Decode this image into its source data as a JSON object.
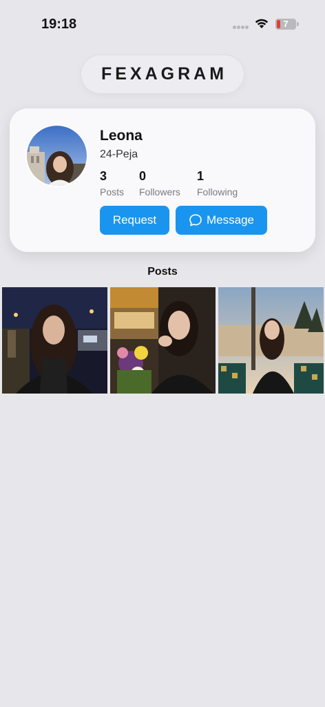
{
  "status_bar": {
    "time": "19:18",
    "battery_level": "7",
    "icons": [
      "cellular-dots-icon",
      "wifi-icon",
      "battery-icon"
    ]
  },
  "app": {
    "logo": "FEXAGRAM"
  },
  "profile": {
    "name": "Leona",
    "subtitle": "24-Peja",
    "stats": [
      {
        "value": "3",
        "label": "Posts"
      },
      {
        "value": "0",
        "label": "Followers"
      },
      {
        "value": "1",
        "label": "Following"
      }
    ],
    "request_label": "Request",
    "message_label": "Message"
  },
  "posts": {
    "heading": "Posts",
    "items": [
      {
        "name": "post-night-street"
      },
      {
        "name": "post-flowers-cafe"
      },
      {
        "name": "post-window-seaside"
      }
    ]
  },
  "colors": {
    "background": "#e7e7eb",
    "card": "#f9f9fb",
    "accent": "#1a95ef"
  }
}
